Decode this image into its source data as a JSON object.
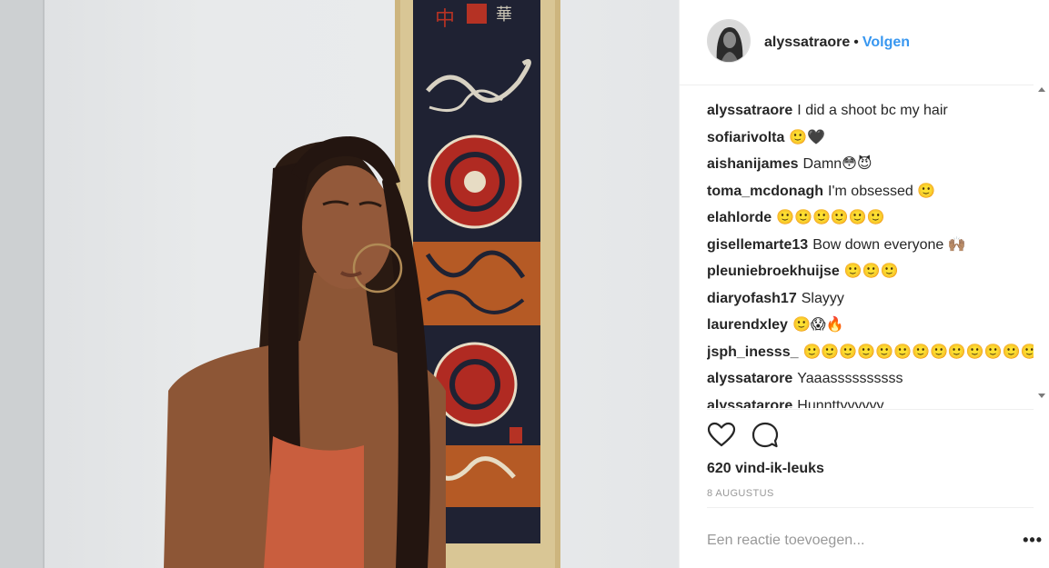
{
  "post": {
    "username": "alyssatraore",
    "separator": "•",
    "follow_label": "Volgen",
    "likes": "620 vind-ik-leuks",
    "date": "8 AUGUSTUS",
    "add_comment_placeholder": "Een reactie toevoegen...",
    "more_label": "•••"
  },
  "comments": [
    {
      "user": "alyssatraore",
      "text": "I did a shoot bc my hair"
    },
    {
      "user": "sofiarivolta",
      "text": "🙂🖤"
    },
    {
      "user": "aishanijames",
      "text": "Damn😳😈"
    },
    {
      "user": "toma_mcdonagh",
      "text": "I'm obsessed 🙂"
    },
    {
      "user": "elahlorde",
      "text": "🙂🙂🙂🙂🙂🙂"
    },
    {
      "user": "gisellemarte13",
      "text": "Bow down everyone 🙌🏽"
    },
    {
      "user": "pleuniebroekhuijse",
      "text": "🙂🙂🙂"
    },
    {
      "user": "diaryofash17",
      "text": "Slayyy"
    },
    {
      "user": "laurendxley",
      "text": "🙂😱🔥"
    },
    {
      "user": "jsph_inesss_",
      "text": "🙂🙂🙂🙂🙂🙂🙂🙂🙂🙂🙂🙂🙂"
    },
    {
      "user": "alyssatarore",
      "text": "Yaaassssssssss"
    },
    {
      "user": "alyssatarore",
      "text": "Hunnttyyyyyy"
    }
  ],
  "icons": {
    "like": "heart-icon",
    "comment": "comment-bubble-icon",
    "more": "more-options-icon"
  },
  "colors": {
    "accent": "#3897f0",
    "text": "#262626",
    "muted": "#999999",
    "border": "#efefef"
  }
}
